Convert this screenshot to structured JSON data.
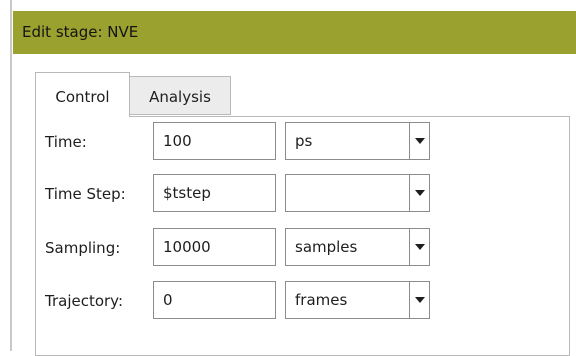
{
  "header": {
    "title": "Edit stage: NVE"
  },
  "tabs": [
    {
      "label": "Control",
      "active": true
    },
    {
      "label": "Analysis",
      "active": false
    }
  ],
  "rows": [
    {
      "label": "Time:",
      "value": "100",
      "unit": "ps"
    },
    {
      "label": "Time Step:",
      "value": "$tstep",
      "unit": ""
    },
    {
      "label": "Sampling:",
      "value": "10000",
      "unit": "samples"
    },
    {
      "label": "Trajectory:",
      "value": "0",
      "unit": "frames"
    }
  ],
  "colors": {
    "header_bg": "#9ba12f",
    "inactive_tab_bg": "#ececec"
  },
  "icons": {
    "dropdown": "chevron-down-icon"
  }
}
